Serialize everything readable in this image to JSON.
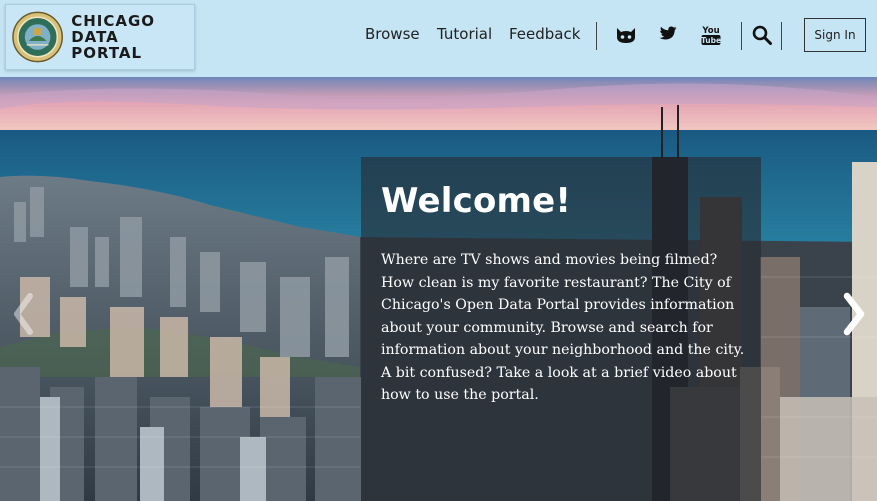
{
  "logo": {
    "line1": "CHICAGO",
    "line2": "DATA PORTAL",
    "seal_icon": "chicago-city-seal"
  },
  "nav": {
    "browse": "Browse",
    "tutorial": "Tutorial",
    "feedback": "Feedback",
    "social_icons": [
      "github-icon",
      "twitter-icon",
      "youtube-icon"
    ],
    "search_icon": "search-icon",
    "sign_in": "Sign In"
  },
  "hero": {
    "title": "Welcome!",
    "body": "Where are TV shows and movies being filmed? How clean is my favorite restaurant? The City of Chicago's Open Data Portal provides information about your community. Browse and search for information about your neighborhood and the city. A bit confused? Take a look at a brief video about how to use the portal.",
    "prev_icon": "chevron-left-icon",
    "next_icon": "chevron-right-icon"
  },
  "colors": {
    "header_bg": "#c5e4f4",
    "overlay": "#262c32",
    "lake": "#1f6f93"
  }
}
